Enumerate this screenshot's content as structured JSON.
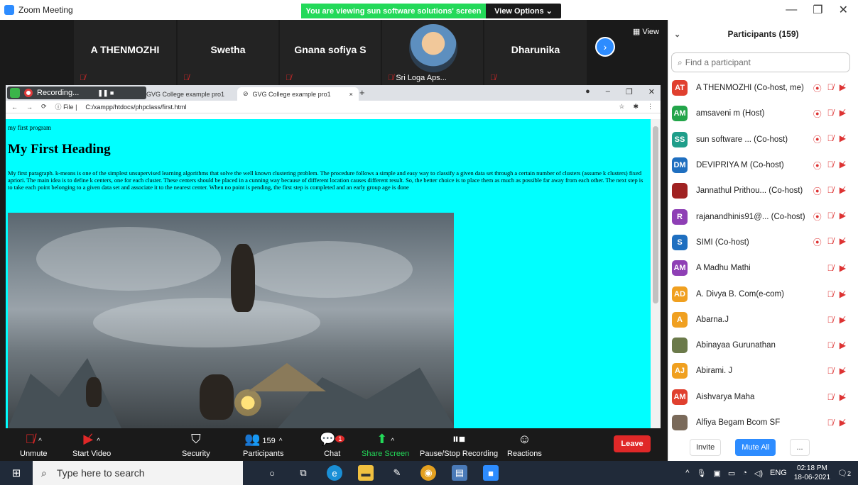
{
  "window": {
    "title": "Zoom Meeting",
    "min": "—",
    "restore": "❐",
    "close": "✕"
  },
  "banner": {
    "text": "You are viewing sun software solutions' screen",
    "view_options": "View Options ⌄"
  },
  "video_tiles": [
    {
      "name": "A THENMOZHI"
    },
    {
      "name": "Swetha"
    },
    {
      "name": "Gnana sofiya S"
    },
    {
      "name": "Sri Loga Aps..."
    },
    {
      "name": "Dharunika"
    }
  ],
  "view_label": "View",
  "browser": {
    "recording_label": "Recording...",
    "tab1": "GVG College example pro1",
    "tab2": "GVG College example pro1",
    "url_prefix": "File",
    "url": "C:/xampp/htdocs/phpclass/first.html",
    "tab_close": "×",
    "tab_new": "+"
  },
  "page": {
    "small_text": "my first program",
    "heading": "My First Heading",
    "paragraph": "My first paragraph. k-means is one of the simplest unsupervised learning algorithms that solve the well known clustering problem. The procedure follows a simple and easy way to classify a given data set through a certain number of clusters (assume k clusters) fixed apriori. The main idea is to define k centers, one for each cluster. These centers should be placed in a cunning way because of different location causes different result. So, the better choice is to place them as much as possible far away from each other. The next step is to take each point belonging to a given data set and associate it to the nearest center. When no point is pending, the first step is completed and an early group age is done"
  },
  "toolbar": {
    "unmute": "Unmute",
    "start_video": "Start Video",
    "security": "Security",
    "participants": "Participants",
    "participants_count": "159",
    "chat": "Chat",
    "chat_badge": "1",
    "share_screen": "Share Screen",
    "recording": "Pause/Stop Recording",
    "reactions": "Reactions",
    "leave": "Leave"
  },
  "panel": {
    "title": "Participants (159)",
    "search_placeholder": "Find a participant",
    "participants": [
      {
        "initials": "AT",
        "color": "#e0402f",
        "name": "A THENMOZHI (Co-host, me)",
        "rec": true
      },
      {
        "initials": "AM",
        "color": "#23a54a",
        "name": "amsaveni m (Host)",
        "rec": true
      },
      {
        "initials": "SS",
        "color": "#1f9e8a",
        "name": "sun software ... (Co-host)",
        "rec": true
      },
      {
        "initials": "DM",
        "color": "#1f6fc0",
        "name": "DEVIPRIYA M (Co-host)",
        "rec": true
      },
      {
        "initials": "",
        "color": "#a02222",
        "name": "Jannathul Prithou... (Co-host)",
        "rec": true
      },
      {
        "initials": "R",
        "color": "#8e3fb5",
        "name": "rajanandhinis91@... (Co-host)",
        "rec": true
      },
      {
        "initials": "S",
        "color": "#1f6fc0",
        "name": "SIMI (Co-host)",
        "rec": true
      },
      {
        "initials": "AM",
        "color": "#8e3fb5",
        "name": "A Madhu Mathi",
        "rec": false
      },
      {
        "initials": "AD",
        "color": "#f0a020",
        "name": "A. Divya B. Com(e-com)",
        "rec": false
      },
      {
        "initials": "A",
        "color": "#f0a020",
        "name": "Abarna.J",
        "rec": false
      },
      {
        "initials": "",
        "color": "#6b7a4a",
        "name": "Abinayaa Gurunathan",
        "rec": false
      },
      {
        "initials": "AJ",
        "color": "#f0a020",
        "name": "Abirami. J",
        "rec": false
      },
      {
        "initials": "AM",
        "color": "#e0402f",
        "name": "Aishvarya Maha",
        "rec": false
      },
      {
        "initials": "",
        "color": "#7a6a5a",
        "name": "Alfiya Begam Bcom SF",
        "rec": false
      }
    ],
    "invite": "Invite",
    "mute_all": "Mute All",
    "more": "..."
  },
  "taskbar": {
    "search_placeholder": "Type here to search",
    "lang": "ENG",
    "time": "02:18 PM",
    "date": "18-06-2021",
    "notif": "2"
  }
}
